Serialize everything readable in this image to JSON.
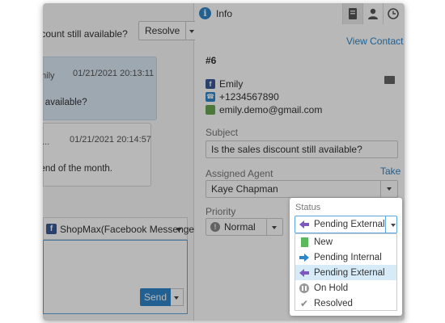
{
  "chat": {
    "title": "discount still available?",
    "resolve_label": "Resolve",
    "messages": [
      {
        "sender": "mily",
        "timestamp": "01/21/2021 20:13:11",
        "body": "still available?"
      },
      {
        "sender": "o...",
        "timestamp": "01/21/2021 20:14:57",
        "body": "til end of the month."
      }
    ],
    "channel": "ShopMax(Facebook Messenger)",
    "send_label": "Send"
  },
  "info": {
    "title": "Info",
    "view_contact": "View Contact",
    "ticket_number": "#6",
    "contact": {
      "name": "Emily",
      "phone": "+1234567890",
      "email": "emily.demo@gmail.com"
    },
    "subject_label": "Subject",
    "subject_value": "Is the sales discount still available?",
    "agent_label": "Assigned Agent",
    "take_label": "Take",
    "agent_value": "Kaye Chapman",
    "priority_label": "Priority",
    "priority_value": "Normal"
  },
  "status": {
    "label": "Status",
    "selected": "Pending External",
    "options": [
      "New",
      "Pending Internal",
      "Pending External",
      "On Hold",
      "Resolved"
    ]
  },
  "icons": {
    "info": "info-icon",
    "header_buttons": [
      "address-book-icon",
      "user-icon",
      "clock-icon"
    ]
  },
  "colors": {
    "accent": "#2e86c9",
    "pending_external": "#7e57c2",
    "pending_internal": "#2e86c9",
    "new": "#5cb85c"
  }
}
